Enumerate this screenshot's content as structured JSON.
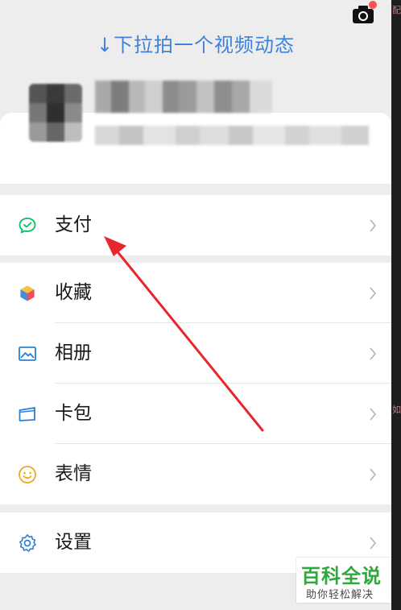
{
  "header": {
    "pull_hint": "↓下拉拍一个视频动态",
    "camera_icon": "camera-icon",
    "notification_color": "#fa5151"
  },
  "menu": {
    "pay": {
      "label": "支付",
      "icon": "wechat-pay-icon",
      "icon_color": "#07c160"
    },
    "favorites": {
      "label": "收藏",
      "icon": "cube-icon"
    },
    "album": {
      "label": "相册",
      "icon": "image-icon",
      "icon_color": "#2782d7"
    },
    "cards": {
      "label": "卡包",
      "icon": "card-icon",
      "icon_color": "#2782d7"
    },
    "stickers": {
      "label": "表情",
      "icon": "smiley-icon",
      "icon_color": "#f5a623"
    },
    "settings": {
      "label": "设置",
      "icon": "gear-icon",
      "icon_color": "#2782d7"
    }
  },
  "accent": "#3f83d9",
  "annotation_arrow_color": "#e8262b",
  "watermark": {
    "title": "百科全说",
    "subtitle": "助你轻松解决",
    "color": "#2eaa3b"
  },
  "edge_strip": [
    "配",
    "如"
  ]
}
